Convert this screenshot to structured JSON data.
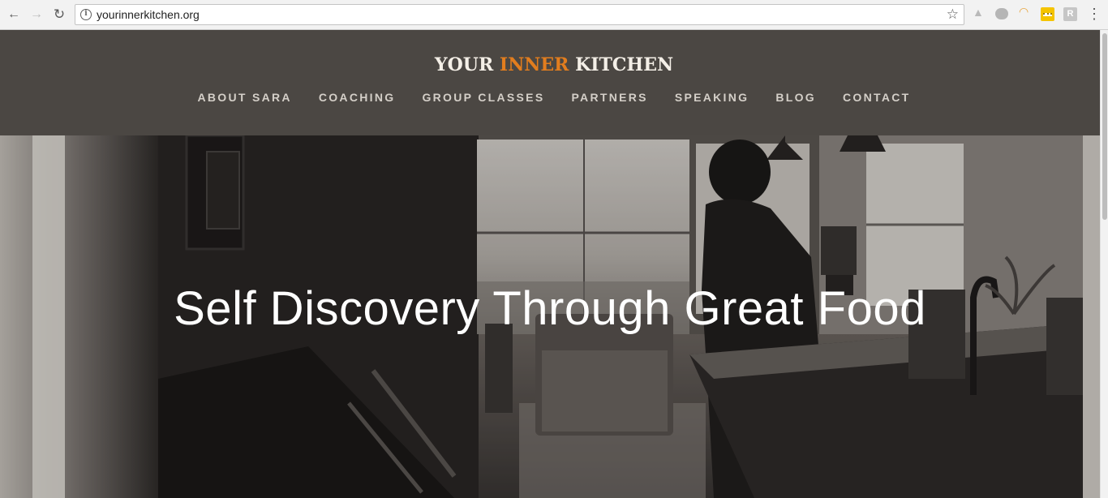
{
  "browser": {
    "url": "yourinnerkitchen.org",
    "back_icon": "←",
    "forward_icon": "→",
    "reload_icon": "↻",
    "info_icon": "i",
    "star_icon": "☆",
    "menu_icon": "⋮"
  },
  "site": {
    "logo": {
      "part1": "YOUR ",
      "part2": "INNER",
      "part3": " KITCHEN"
    },
    "accent_color": "#e27d1e",
    "header_bg": "#4b4743",
    "nav": [
      {
        "label": "ABOUT SARA"
      },
      {
        "label": "COACHING"
      },
      {
        "label": "GROUP CLASSES"
      },
      {
        "label": "PARTNERS"
      },
      {
        "label": "SPEAKING"
      },
      {
        "label": "BLOG"
      },
      {
        "label": "CONTACT"
      }
    ]
  },
  "hero": {
    "title": "Self Discovery Through Great Food"
  }
}
